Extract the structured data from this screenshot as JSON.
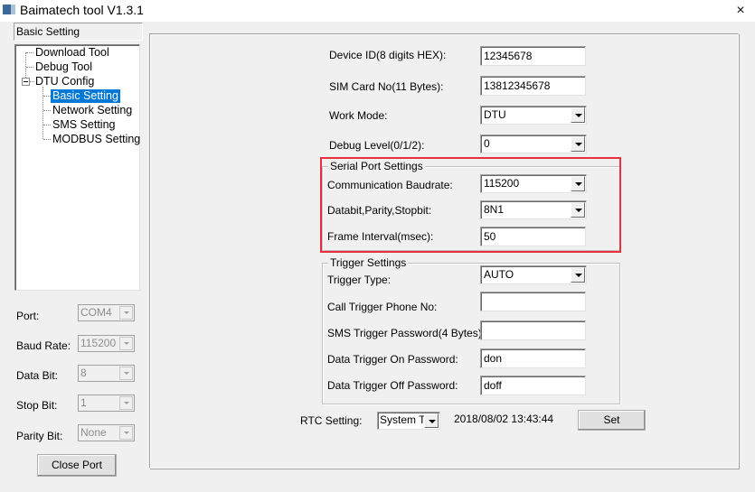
{
  "window": {
    "title": "Baimatech tool V1.3.1",
    "close_icon": "×"
  },
  "sidebar": {
    "section_label": "Basic Setting",
    "tree": [
      {
        "label": "Download Tool",
        "level": 0
      },
      {
        "label": "Debug Tool",
        "level": 0
      },
      {
        "label": "DTU Config",
        "level": 0,
        "expanded": true
      },
      {
        "label": "Basic Setting",
        "level": 1,
        "selected": true
      },
      {
        "label": "Network Setting",
        "level": 1
      },
      {
        "label": "SMS Setting",
        "level": 1
      },
      {
        "label": "MODBUS Setting",
        "level": 1
      }
    ],
    "port": {
      "label": "Port:",
      "value": "COM4"
    },
    "baud_rate": {
      "label": "Baud Rate:",
      "value": "115200"
    },
    "data_bit": {
      "label": "Data Bit:",
      "value": "8"
    },
    "stop_bit": {
      "label": "Stop Bit:",
      "value": "1"
    },
    "parity_bit": {
      "label": "Parity Bit:",
      "value": "None"
    },
    "close_port_label": "Close Port"
  },
  "basic": {
    "device_id": {
      "label": "Device ID(8 digits HEX):",
      "value": "12345678"
    },
    "sim_card": {
      "label": "SIM Card No(11 Bytes):",
      "value": "13812345678"
    },
    "work_mode": {
      "label": "Work Mode:",
      "value": "DTU"
    },
    "debug_level": {
      "label": "Debug Level(0/1/2):",
      "value": "0"
    }
  },
  "serial": {
    "title": "Serial Port Settings",
    "baudrate": {
      "label": "Communication Baudrate:",
      "value": "115200"
    },
    "format": {
      "label": "Databit,Parity,Stopbit:",
      "value": "8N1"
    },
    "frame_interval": {
      "label": "Frame Interval(msec):",
      "value": "50"
    }
  },
  "trigger": {
    "title": "Trigger Settings",
    "type": {
      "label": "Trigger Type:",
      "value": "AUTO"
    },
    "call_phone": {
      "label": "Call Trigger Phone No:",
      "value": ""
    },
    "sms_password": {
      "label": "SMS Trigger Password(4 Bytes):",
      "value": ""
    },
    "data_on": {
      "label": "Data Trigger On Password:",
      "value": "don"
    },
    "data_off": {
      "label": "Data Trigger Off Password:",
      "value": "doff"
    }
  },
  "rtc": {
    "label": "RTC Setting:",
    "mode": "System Tir",
    "datetime": "2018/08/02 13:43:44",
    "set_label": "Set"
  },
  "colors": {
    "highlight": "#e8303a",
    "selection": "#0078d7",
    "background": "#f0f0f0"
  }
}
